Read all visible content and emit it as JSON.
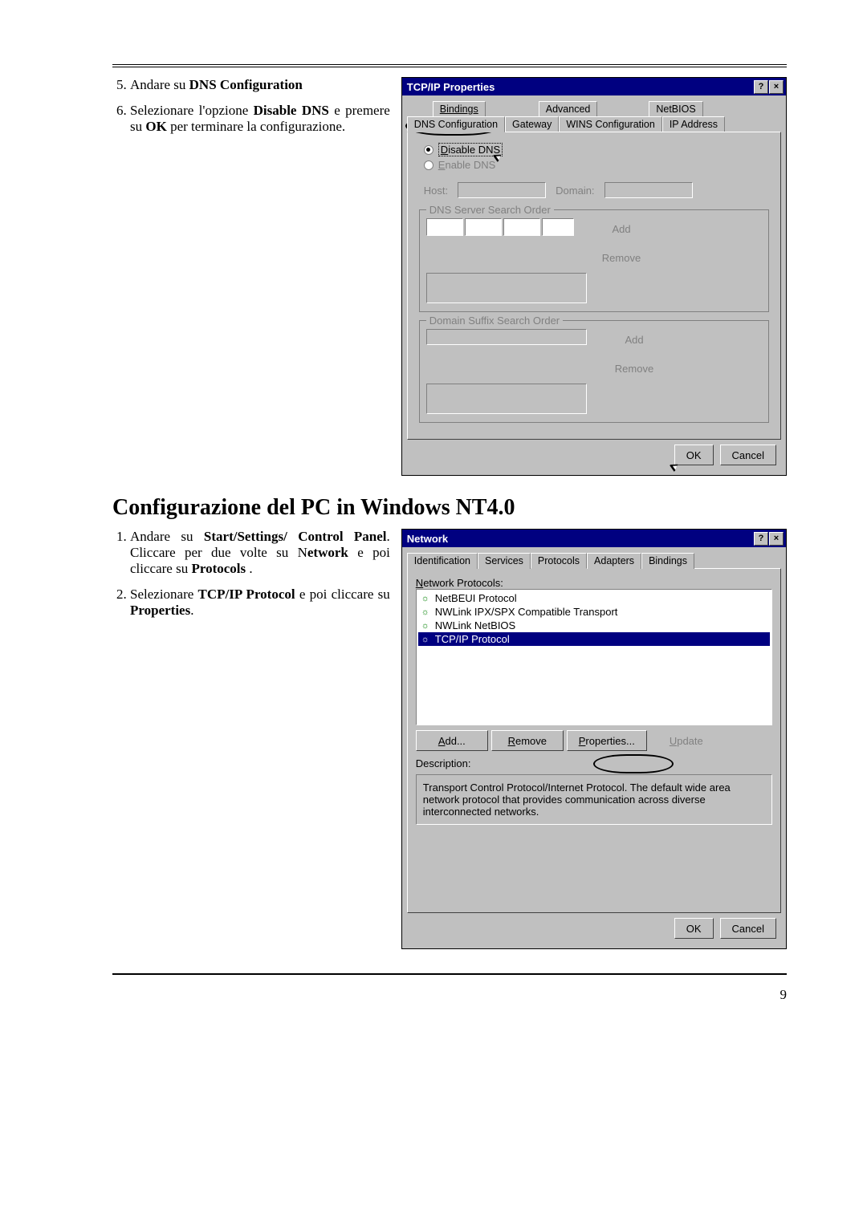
{
  "page_number": "9",
  "section1": {
    "item5_prefix": "Andare su ",
    "item5_bold": "DNS Configuration",
    "item6_p1": "Selezionare l'opzione ",
    "item6_b1": "Disable DNS",
    "item6_p2": " e premere su  ",
    "item6_b2": "OK",
    "item6_p3": " per terminare la configurazione."
  },
  "tcpip": {
    "title": "TCP/IP Properties",
    "tabs_row1": [
      "Bindings",
      "Advanced",
      "NetBIOS"
    ],
    "tabs_row2": [
      "DNS Configuration",
      "Gateway",
      "WINS Configuration",
      "IP Address"
    ],
    "disable_dns": "Disable DNS",
    "enable_dns": "Enable DNS",
    "host": "Host:",
    "domain": "Domain:",
    "dns_order": "DNS Server Search Order",
    "add": "Add",
    "remove": "Remove",
    "suffix_order": "Domain Suffix Search Order",
    "add2": "Add",
    "remove2": "Remove",
    "ok": "OK",
    "cancel": "Cancel"
  },
  "section_heading": "Configurazione del  PC in Windows NT4.0",
  "section2": {
    "item1_p1": "Andare su ",
    "item1_b1": "Start/Settings/ Control Panel",
    "item1_p2": ". Cliccare per  due volte su N",
    "item1_b2": "etwork",
    "item1_p3": " e poi cliccare su ",
    "item1_b3": "Protocols",
    "item1_p4": " .",
    "item2_p1": "Selezionare ",
    "item2_b1": "TCP/IP Protocol",
    "item2_p2": " e poi cliccare su  ",
    "item2_b2": "Properties",
    "item2_p3": "."
  },
  "network": {
    "title": "Network",
    "tabs": [
      "Identification",
      "Services",
      "Protocols",
      "Adapters",
      "Bindings"
    ],
    "list_label": "Network Protocols:",
    "protocols": [
      "NetBEUI Protocol",
      "NWLink IPX/SPX Compatible Transport",
      "NWLink NetBIOS",
      "TCP/IP Protocol"
    ],
    "add": "Add...",
    "remove": "Remove",
    "properties": "Properties...",
    "update": "Update",
    "description_label": "Description:",
    "description": "Transport Control Protocol/Internet Protocol. The default wide area network protocol that provides communication across diverse interconnected networks.",
    "ok": "OK",
    "cancel": "Cancel"
  }
}
